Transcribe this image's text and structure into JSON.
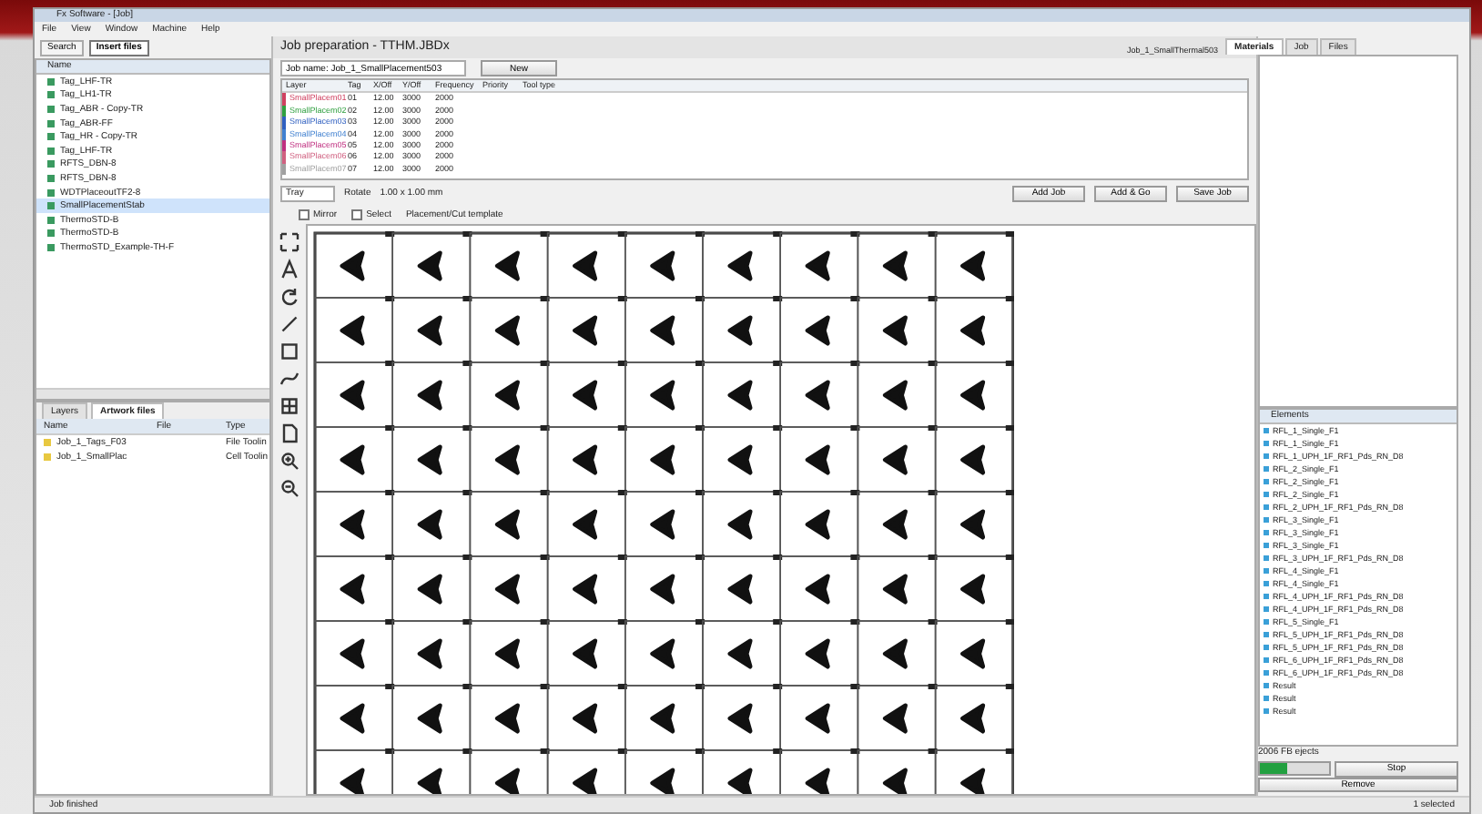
{
  "window": {
    "title": "Fx Software - [Job]"
  },
  "menu": [
    "File",
    "View",
    "Window",
    "Machine",
    "Help"
  ],
  "toolbar": [
    {
      "label": "Search",
      "selected": false
    },
    {
      "label": "Insert files",
      "selected": true
    }
  ],
  "tree": {
    "header": "Name",
    "items": [
      {
        "label": "Tag_LHF-TR",
        "selected": false
      },
      {
        "label": "Tag_LH1-TR",
        "selected": false
      },
      {
        "label": "Tag_ABR - Copy-TR",
        "selected": false
      },
      {
        "label": "Tag_ABR-FF",
        "selected": false
      },
      {
        "label": "Tag_HR - Copy-TR",
        "selected": false
      },
      {
        "label": "Tag_LHF-TR",
        "selected": false
      },
      {
        "label": "RFTS_DBN-8",
        "selected": false
      },
      {
        "label": "RFTS_DBN-8",
        "selected": false
      },
      {
        "label": "WDTPlaceoutTF2-8",
        "selected": false
      },
      {
        "label": "SmallPlacementStab",
        "selected": true
      },
      {
        "label": "ThermoSTD-B",
        "selected": false
      },
      {
        "label": "ThermoSTD-B",
        "selected": false
      },
      {
        "label": "ThermoSTD_Example-TH-F",
        "selected": false
      }
    ]
  },
  "layers_panel": {
    "tabs": [
      {
        "label": "Layers",
        "selected": false
      },
      {
        "label": "Artwork files",
        "selected": true
      }
    ],
    "columns": [
      "Name",
      "File",
      "Type"
    ],
    "rows": [
      [
        "Job_1_Tags_F03",
        "",
        "File Toolin"
      ],
      [
        "Job_1_SmallPlac",
        "",
        "Cell Toolin"
      ]
    ]
  },
  "job": {
    "title": "Job preparation - TTHM.JBDx",
    "name_field": {
      "value": "Job name: Job_1_SmallPlacement503"
    },
    "new_button": "New",
    "columns": [
      "Layer",
      "Tag",
      "X/Off",
      "Y/Off",
      "Frequency",
      "Priority",
      "Tool type"
    ],
    "rows": [
      {
        "color": "#d04060",
        "cells": [
          "SmallPlacem01",
          "01",
          "12.00",
          "3000",
          "2000"
        ]
      },
      {
        "color": "#30a040",
        "cells": [
          "SmallPlacem02",
          "02",
          "12.00",
          "3000",
          "2000"
        ]
      },
      {
        "color": "#3060c0",
        "cells": [
          "SmallPlacem03",
          "03",
          "12.00",
          "3000",
          "2000"
        ]
      },
      {
        "color": "#4080d0",
        "cells": [
          "SmallPlacem04",
          "04",
          "12.00",
          "3000",
          "2000"
        ]
      },
      {
        "color": "#c03080",
        "cells": [
          "SmallPlacem05",
          "05",
          "12.00",
          "3000",
          "2000"
        ]
      },
      {
        "color": "#d06080",
        "cells": [
          "SmallPlacem06",
          "06",
          "12.00",
          "3000",
          "2000"
        ]
      },
      {
        "color": "#a0a0a0",
        "cells": [
          "SmallPlacem07",
          "07",
          "12.00",
          "3000",
          "2000"
        ]
      }
    ],
    "tray": "Tray",
    "rotate": "Rotate",
    "size": "1.00 x 1.00 mm",
    "actions": [
      "Add Job",
      "Add & Go",
      "Save Job"
    ],
    "options": [
      {
        "label": "Mirror",
        "checked": false
      },
      {
        "label": "Select",
        "checked": false
      }
    ],
    "template": "Placement/Cut template"
  },
  "right": {
    "title": "Job_1_SmallThermal503",
    "tabs": [
      {
        "label": "Materials",
        "selected": true
      },
      {
        "label": "Job",
        "selected": false
      },
      {
        "label": "Files",
        "selected": false
      }
    ],
    "list_header": "Elements",
    "elements": [
      "RFL_1_Single_F1",
      "RFL_1_Single_F1",
      "RFL_1_UPH_1F_RF1_Pds_RN_D8",
      "RFL_2_Single_F1",
      "RFL_2_Single_F1",
      "RFL_2_Single_F1",
      "RFL_2_UPH_1F_RF1_Pds_RN_D8",
      "RFL_3_Single_F1",
      "RFL_3_Single_F1",
      "RFL_3_Single_F1",
      "RFL_3_UPH_1F_RF1_Pds_RN_D8",
      "RFL_4_Single_F1",
      "RFL_4_Single_F1",
      "RFL_4_UPH_1F_RF1_Pds_RN_D8",
      "RFL_4_UPH_1F_RF1_Pds_RN_D8",
      "RFL_5_Single_F1",
      "RFL_5_UPH_1F_RF1_Pds_RN_D8",
      "RFL_5_UPH_1F_RF1_Pds_RN_D8",
      "RFL_6_UPH_1F_RF1_Pds_RN_D8",
      "RFL_6_UPH_1F_RF1_Pds_RN_D8",
      "Result",
      "Result",
      "Result"
    ],
    "progress_label": "2006 FB ejects",
    "progress": {
      "level": 0.4
    },
    "stop_button": "Stop",
    "remove_button": "Remove"
  },
  "status_bar": {
    "left": "Job finished",
    "right": "1 selected"
  }
}
